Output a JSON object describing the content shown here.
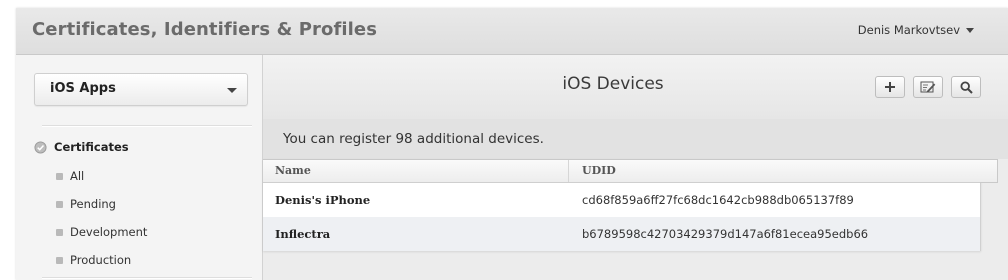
{
  "header": {
    "title": "Certificates, Identifiers & Profiles",
    "user": "Denis Markovtsev"
  },
  "sidebar": {
    "platform_dropdown": "iOS Apps",
    "section": {
      "label": "Certificates",
      "items": [
        {
          "label": "All"
        },
        {
          "label": "Pending"
        },
        {
          "label": "Development"
        },
        {
          "label": "Production"
        }
      ]
    }
  },
  "main": {
    "title": "iOS Devices",
    "toolbar": {
      "add_icon": "plus-icon",
      "edit_icon": "edit-icon",
      "search_icon": "search-icon"
    },
    "notice": "You can register 98 additional devices.",
    "table": {
      "columns": [
        "Name",
        "UDID"
      ],
      "rows": [
        {
          "name": "Denis's iPhone",
          "udid": "cd68f859a6ff27fc68dc1642cb988db065137f89"
        },
        {
          "name": "Inflectra",
          "udid": "b6789598c42703429379d147a6f81ecea95edb66"
        }
      ]
    }
  }
}
